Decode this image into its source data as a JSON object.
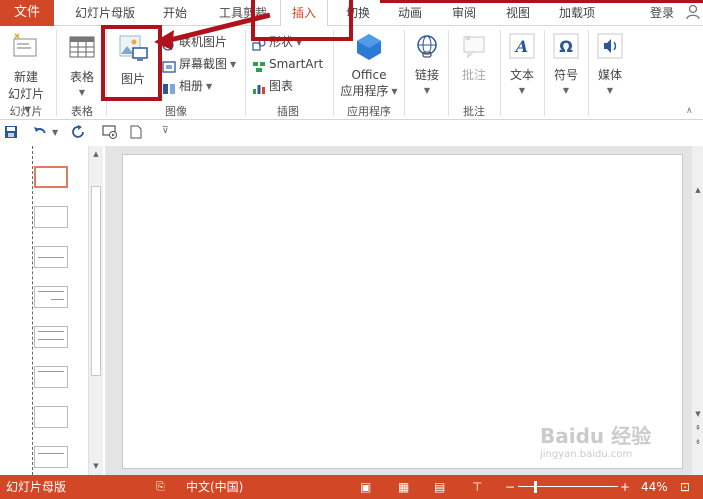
{
  "tabs": {
    "file": "文件",
    "items": [
      "幻灯片母版",
      "开始",
      "工具剪裁",
      "插入",
      "切换",
      "动画",
      "审阅",
      "视图",
      "加载项"
    ],
    "active": "插入",
    "login": "登录"
  },
  "ribbon": {
    "slides": {
      "new_slide": "新建",
      "new_slide_line2": "幻灯片",
      "group": "幻灯片"
    },
    "tables": {
      "table": "表格",
      "group": "表格"
    },
    "images": {
      "picture": "图片",
      "online_picture": "联机图片",
      "screenshot": "屏幕截图",
      "album": "相册",
      "group": "图像"
    },
    "illustrations": {
      "shapes": "形状",
      "smartart": "SmartArt",
      "chart": "图表",
      "group": "插图"
    },
    "apps": {
      "office": "Office",
      "office_line2": "应用程序",
      "group": "应用程序"
    },
    "links": {
      "link": "链接"
    },
    "comments": {
      "comment": "批注",
      "group": "批注"
    },
    "text": {
      "text": "文本"
    },
    "symbols": {
      "symbol": "符号"
    },
    "media": {
      "media": "媒体"
    }
  },
  "statusbar": {
    "view_name": "幻灯片母版",
    "language": "中文(中国)",
    "zoom": "44%"
  },
  "watermark": "Baidu 经验",
  "watermark_url": "jingyan.baidu.com",
  "colors": {
    "accent": "#d24726",
    "annotation": "#b0121b"
  }
}
